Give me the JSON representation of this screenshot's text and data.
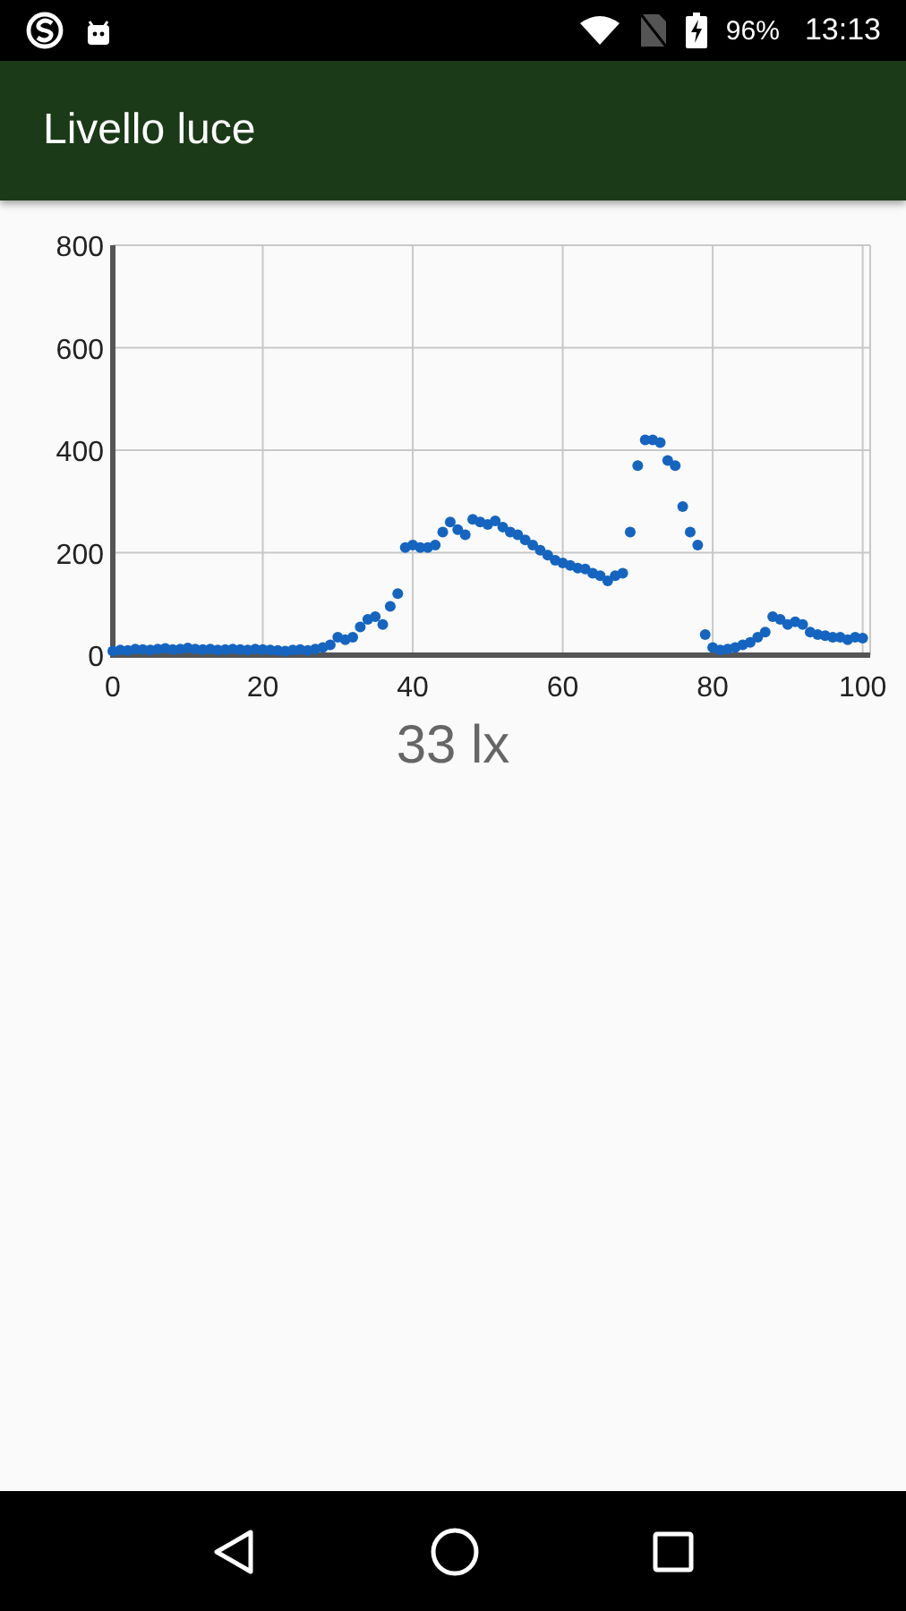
{
  "status_bar": {
    "battery": "96%",
    "time": "13:13"
  },
  "app_bar": {
    "title": "Livello luce"
  },
  "chart": {
    "chart_data": {
      "type": "scatter",
      "grid": true,
      "xlim": [
        0,
        101
      ],
      "ylim": [
        0,
        800
      ],
      "xticks": [
        0,
        20,
        40,
        60,
        80,
        100
      ],
      "yticks": [
        0,
        200,
        400,
        600,
        800
      ],
      "x": [
        0,
        1,
        2,
        3,
        4,
        5,
        6,
        7,
        8,
        9,
        10,
        11,
        12,
        13,
        14,
        15,
        16,
        17,
        18,
        19,
        20,
        21,
        22,
        23,
        24,
        25,
        26,
        27,
        28,
        29,
        30,
        31,
        32,
        33,
        34,
        35,
        36,
        37,
        38,
        39,
        40,
        41,
        42,
        43,
        44,
        45,
        46,
        47,
        48,
        49,
        50,
        51,
        52,
        53,
        54,
        55,
        56,
        57,
        58,
        59,
        60,
        61,
        62,
        63,
        64,
        65,
        66,
        67,
        68,
        69,
        70,
        71,
        72,
        73,
        74,
        75,
        76,
        77,
        78,
        79,
        80,
        81,
        82,
        83,
        84,
        85,
        86,
        87,
        88,
        89,
        90,
        91,
        92,
        93,
        94,
        95,
        96,
        97,
        98,
        99,
        100
      ],
      "series": [
        {
          "color": "#1565c0",
          "values": [
            8,
            10,
            9,
            12,
            11,
            10,
            12,
            13,
            11,
            12,
            14,
            12,
            11,
            12,
            10,
            11,
            12,
            11,
            10,
            12,
            11,
            10,
            9,
            8,
            10,
            11,
            9,
            12,
            15,
            20,
            35,
            30,
            35,
            55,
            70,
            75,
            60,
            95,
            120,
            210,
            215,
            210,
            210,
            215,
            240,
            260,
            245,
            235,
            265,
            260,
            255,
            262,
            250,
            240,
            235,
            225,
            215,
            205,
            195,
            185,
            180,
            175,
            170,
            168,
            160,
            155,
            145,
            155,
            160,
            240,
            370,
            420,
            420,
            415,
            380,
            370,
            290,
            240,
            215,
            40,
            15,
            10,
            12,
            15,
            20,
            25,
            35,
            45,
            75,
            70,
            60,
            65,
            60,
            45,
            40,
            38,
            35,
            35,
            30,
            35,
            33
          ]
        }
      ]
    }
  },
  "reading": "33 lx"
}
